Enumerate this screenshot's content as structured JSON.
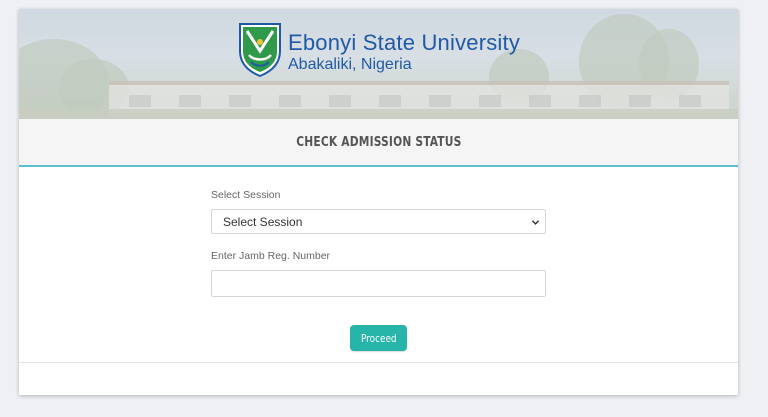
{
  "header": {
    "university_name": "Ebonyi State University",
    "university_location": "Abakaliki, Nigeria",
    "page_title": "CHECK ADMISSION STATUS"
  },
  "form": {
    "session_label": "Select Session",
    "session_selected": "Select Session",
    "jamb_label": "Enter Jamb Reg. Number",
    "jamb_value": "",
    "submit_label": "Proceed"
  },
  "icons": {
    "logo": "university-crest-icon",
    "select_arrow": "chevron-down-icon"
  },
  "colors": {
    "brand_text": "#1f5aa6",
    "accent_line": "#5bc0cf",
    "button": "#26b5a8",
    "crest_green": "#2e9a4a"
  }
}
